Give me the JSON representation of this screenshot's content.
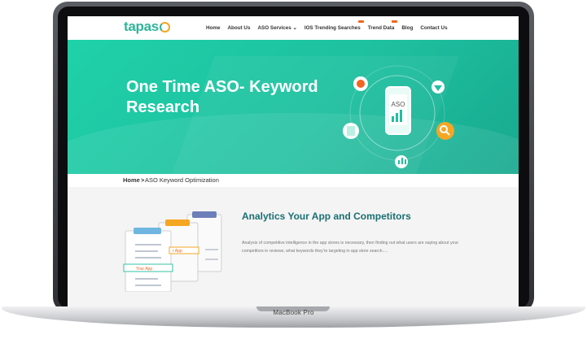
{
  "nav": {
    "logo": "tapas",
    "items": [
      {
        "label": "Home",
        "badge": false
      },
      {
        "label": "About Us",
        "badge": false
      },
      {
        "label": "ASO Services ⌄",
        "badge": false
      },
      {
        "label": "IOS Trending Searches",
        "badge": true
      },
      {
        "label": "Trend Data",
        "badge": true
      },
      {
        "label": "Blog",
        "badge": false
      },
      {
        "label": "Contact Us",
        "badge": false
      }
    ]
  },
  "hero": {
    "title": "One Time ASO- Keyword Research",
    "phone_text": "ASO",
    "colors": {
      "start": "#1fd1a8",
      "end": "#18a98f"
    }
  },
  "breadcrumb": {
    "home": "Home",
    "separator": ">",
    "current": "ASO Keyword Optimization"
  },
  "section": {
    "title": "Analytics Your App and Competitors",
    "description": "Analysis of competitive intelligence in the app stores is necessary, then finding out what users are saying about your competitors in reviews, what keywords they're targeting in app store search.....",
    "clipboard_labels": [
      "Your App",
      "r App"
    ]
  },
  "device": {
    "label": "MacBook Pro"
  }
}
